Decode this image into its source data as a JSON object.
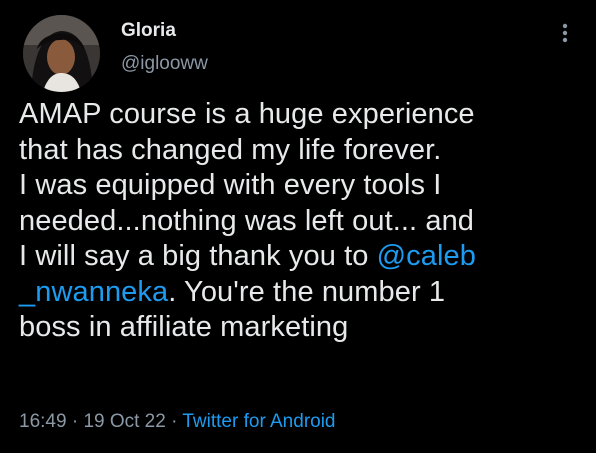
{
  "author": {
    "name": "Gloria",
    "handle": "@iglooww",
    "avatar_icon": "profile-photo"
  },
  "more_icon": "more-vertical-icon",
  "tweet": {
    "lines": [
      {
        "parts": [
          {
            "text": "AMAP course is a huge experience",
            "type": "text"
          }
        ]
      },
      {
        "parts": [
          {
            "text": "that has changed my life forever.",
            "type": "text"
          }
        ]
      },
      {
        "parts": [
          {
            "text": "I was equipped with every tools I",
            "type": "text"
          }
        ]
      },
      {
        "parts": [
          {
            "text": "needed...nothing was left out... and",
            "type": "text"
          }
        ]
      },
      {
        "parts": [
          {
            "text": "I will say a big thank you to ",
            "type": "text"
          },
          {
            "text": "@caleb",
            "type": "mention"
          }
        ]
      },
      {
        "parts": [
          {
            "text": "_nwanneka",
            "type": "mention"
          },
          {
            "text": ". You're the number 1",
            "type": "text"
          }
        ]
      },
      {
        "parts": [
          {
            "text": "boss in affiliate marketing",
            "type": "text"
          }
        ]
      }
    ]
  },
  "meta": {
    "time": "16:49",
    "separator": " · ",
    "date": "19 Oct 22",
    "source": "Twitter for Android"
  },
  "colors": {
    "background": "#000000",
    "text": "#e7e9ea",
    "secondary": "#8b98a5",
    "link": "#1d9bf0"
  }
}
